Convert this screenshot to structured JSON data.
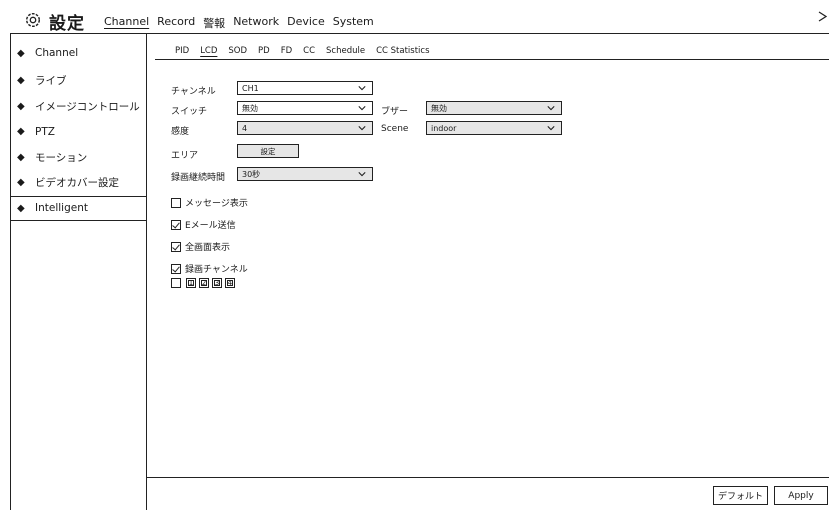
{
  "header": {
    "title": "設定",
    "nav": [
      "Channel",
      "Record",
      "警報",
      "Network",
      "Device",
      "System"
    ],
    "active_nav": "Channel",
    "close_label": "×"
  },
  "sidebar": {
    "items": [
      {
        "label": "Channel"
      },
      {
        "label": "ライブ"
      },
      {
        "label": "イメージコントロール"
      },
      {
        "label": "PTZ"
      },
      {
        "label": "モーション"
      },
      {
        "label": "ビデオカバー設定"
      },
      {
        "label": "Intelligent"
      }
    ],
    "active": "Intelligent",
    "icon": "◆"
  },
  "subtabs": {
    "items": [
      "PID",
      "LCD",
      "SOD",
      "PD",
      "FD",
      "CC",
      "Schedule",
      "CC Statistics"
    ],
    "active": "LCD"
  },
  "form": {
    "channel_label": "チャンネル",
    "channel_value": "CH1",
    "switch_label": "スイッチ",
    "switch_value": "無効",
    "buzzer_label": "ブザー",
    "buzzer_value": "無効",
    "sensitivity_label": "感度",
    "sensitivity_value": "4",
    "scene_label": "Scene",
    "scene_value": "indoor",
    "area_label": "エリア",
    "area_button": "設定",
    "duration_label": "録画継続時間",
    "duration_value": "30秒"
  },
  "checks": {
    "message": {
      "label": "メッセージ表示",
      "checked": false
    },
    "email": {
      "label": "Eメール送信",
      "checked": true
    },
    "fullscreen": {
      "label": "全画面表示",
      "checked": true
    },
    "record_channel": {
      "label": "録画チャンネル",
      "checked": true
    }
  },
  "channels": {
    "numbers": [
      "1",
      "2",
      "3",
      "4"
    ]
  },
  "footer": {
    "default_label": "デフォルト",
    "apply_label": "Apply"
  }
}
